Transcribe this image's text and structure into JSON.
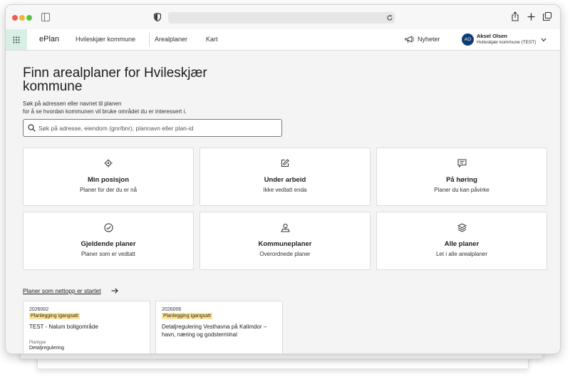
{
  "browser": {
    "address_value": ""
  },
  "nav": {
    "brand": "ePlan",
    "municipality": "Hvileskjær kommune",
    "links": [
      "Arealplaner",
      "Kart"
    ],
    "news_label": "Nyheter",
    "user": {
      "initials": "AO",
      "name": "Aksel Olsen",
      "org": "Hvileskjær kommune (TEST)"
    }
  },
  "hero": {
    "title": "Finn arealplaner for Hvileskjær kommune",
    "intro_line1": "Søk på adressen eller navnet til planen",
    "intro_line2": "for å se hvordan kommunen vil bruke området du er interessert i.",
    "search_placeholder": "Søk på adresse, eiendom (gnr/bnr), plannavn eller plan-id"
  },
  "tiles": [
    {
      "icon": "location-icon",
      "title": "Min posisjon",
      "subtitle": "Planer for der du er nå"
    },
    {
      "icon": "edit-icon",
      "title": "Under arbeid",
      "subtitle": "Ikke vedtatt enda"
    },
    {
      "icon": "comment-icon",
      "title": "På høring",
      "subtitle": "Planer du kan påvirke"
    },
    {
      "icon": "check-circle-icon",
      "title": "Gjeldende planer",
      "subtitle": "Planer som er vedtatt"
    },
    {
      "icon": "map-pin-icon",
      "title": "Kommuneplaner",
      "subtitle": "Overordnede planer"
    },
    {
      "icon": "layers-icon",
      "title": "Alle planer",
      "subtitle": "Let i alle arealplaner"
    }
  ],
  "recent": {
    "link_label": "Planer som nettopp er startet",
    "cards": [
      {
        "id": "2026002",
        "status": "Planlegging igangsatt",
        "name": "TEST - Nalum boligområde",
        "type_label": "Plantype",
        "type_value": "Detaljregulering"
      },
      {
        "id": "2026006",
        "status": "Planlegging igangsatt",
        "name": "Detaljregulering Vesthavna på Kalimdor – havn, næring og godsterminal"
      }
    ]
  },
  "colors": {
    "accent_mint": "#d8efe6",
    "avatar_bg": "#0f3d73",
    "status_bg": "#fbe2a0"
  }
}
